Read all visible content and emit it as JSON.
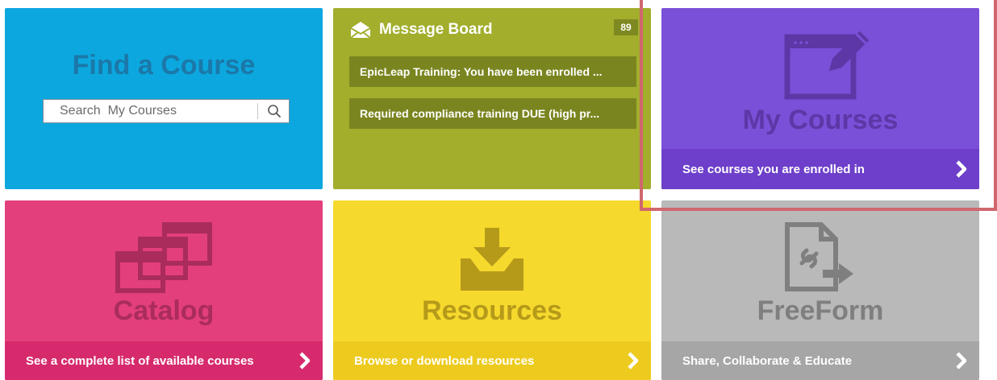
{
  "find_course": {
    "title": "Find a Course",
    "search_placeholder": "Search  My Courses"
  },
  "message_board": {
    "title": "Message Board",
    "count": "89",
    "items": [
      "EpicLeap Training: You have been enrolled ...",
      "Required compliance training DUE (high pr..."
    ]
  },
  "my_courses": {
    "title": "My Courses",
    "footer": "See courses you are enrolled in"
  },
  "catalog": {
    "title": "Catalog",
    "footer": "See a complete list of available courses"
  },
  "resources": {
    "title": "Resources",
    "footer": "Browse or download resources"
  },
  "freeform": {
    "title": "FreeForm",
    "footer": "Share, Collaborate & Educate"
  },
  "colors": {
    "find_course": "#0ca7df",
    "message_board": "#a2ae2c",
    "my_courses": "#7b50d8",
    "catalog": "#e33f7c",
    "resources": "#f6d92d",
    "freeform": "#b9b9b9",
    "highlight": "#d0676f"
  },
  "icons": {
    "search": "magnifier-icon",
    "message_board": "envelope-open-icon",
    "my_courses": "window-pencil-icon",
    "catalog": "stacked-windows-icon",
    "resources": "download-tray-icon",
    "freeform": "document-link-icon",
    "chevron": "chevron-right-icon"
  }
}
